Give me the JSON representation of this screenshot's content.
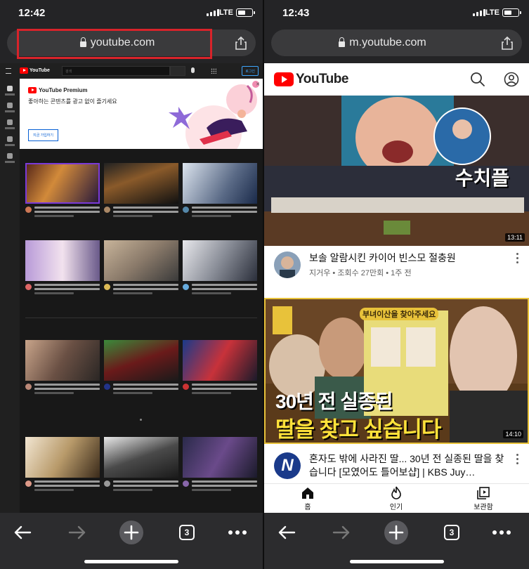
{
  "left_phone": {
    "status": {
      "time": "12:42",
      "network": "LTE"
    },
    "url_bar": {
      "address": "youtube.com"
    },
    "desktop_site": {
      "logo_text": "YouTube",
      "search_placeholder": "검색",
      "login_label": "로그인",
      "premium_banner": {
        "title": "YouTube Premium",
        "subtitle": "좋아하는 콘텐츠를 광고 없이 즐기세요",
        "button": "지금 가입하기"
      }
    },
    "toolbar": {
      "tab_count": "3"
    }
  },
  "right_phone": {
    "status": {
      "time": "12:43",
      "network": "LTE"
    },
    "url_bar": {
      "address": "m.youtube.com"
    },
    "header": {
      "logo_text": "YouTube"
    },
    "videos": [
      {
        "thumbnail_caption": "수치플",
        "duration": "13:11",
        "title": "보솔 알람시킨 카이어 빈스모 절충원",
        "channel_line": "지거우 • 조회수 27만회 • 1주 전"
      },
      {
        "thumbnail_caption_line1": "30년 전 실종된",
        "thumbnail_caption_line2": "딸을 찾고 싶습니다",
        "thumbnail_panel": "부녀이산을 찾아주세요",
        "duration": "14:10",
        "title": "혼자도 밖에 사라진 딸... 30년 전 실종된 딸을 찾습니다 [모였어도 틀어보샵] | KBS Juy…",
        "channel_avatar_letter": "N"
      }
    ],
    "bottom_nav": [
      {
        "label": "홈",
        "icon": "home-icon"
      },
      {
        "label": "인기",
        "icon": "flame-icon"
      },
      {
        "label": "보관함",
        "icon": "library-icon"
      }
    ],
    "toolbar": {
      "tab_count": "3"
    }
  },
  "colors": {
    "yt_red": "#ff0000",
    "highlight_red": "#d8232a",
    "browser_chrome": "#2c2c2e",
    "url_pill": "#3a3a3c"
  }
}
